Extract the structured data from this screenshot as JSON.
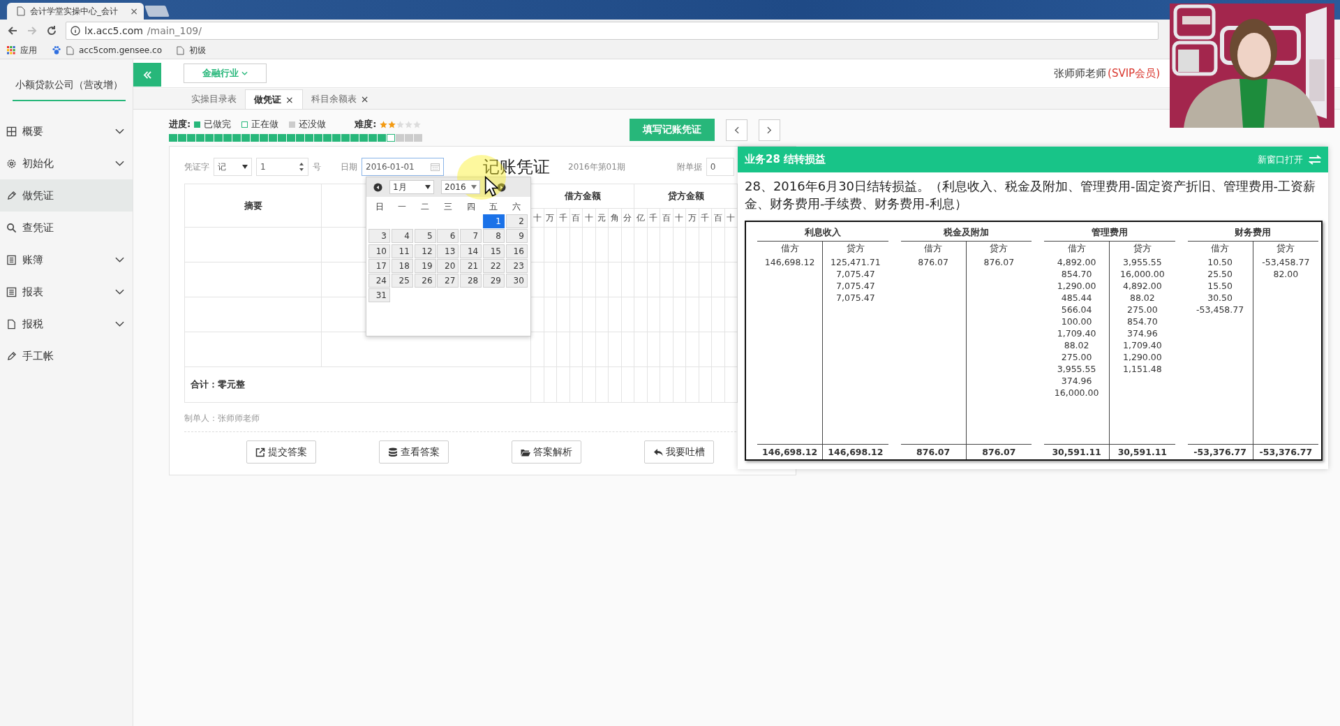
{
  "browser": {
    "tab_title": "会计学堂实操中心_会计",
    "tab_close": "×",
    "url_host": "lx.acc5.com",
    "url_path": "/main_109/",
    "bookmarks": [
      "应用",
      "acc5com.gensee.co",
      "初级"
    ]
  },
  "sidebar": {
    "company": "小额贷款公司（营改增）",
    "items": [
      {
        "label": "概要",
        "kind": "group",
        "selected": false
      },
      {
        "label": "初始化",
        "kind": "group",
        "selected": false
      },
      {
        "label": "做凭证",
        "kind": "link",
        "selected": true
      },
      {
        "label": "查凭证",
        "kind": "link",
        "selected": false
      },
      {
        "label": "账簿",
        "kind": "group",
        "selected": false
      },
      {
        "label": "报表",
        "kind": "group",
        "selected": false
      },
      {
        "label": "报税",
        "kind": "group",
        "selected": false
      },
      {
        "label": "手工帐",
        "kind": "link",
        "selected": false
      }
    ]
  },
  "topbar": {
    "industry": "金融行业",
    "user": "张师师老师",
    "member": "(SVIP会员)"
  },
  "tabs": [
    {
      "label": "实操目录表",
      "selected": false
    },
    {
      "label": "做凭证",
      "selected": true,
      "close": "×"
    },
    {
      "label": "科目余额表",
      "selected": false,
      "close": "×"
    }
  ],
  "progress": {
    "label": "进度:",
    "legend": [
      {
        "label": "已做完",
        "kind": "done"
      },
      {
        "label": "正在做",
        "kind": "current"
      },
      {
        "label": "还没做",
        "kind": "todo"
      }
    ],
    "steps": [
      {
        "kind": "done"
      },
      {
        "kind": "done"
      },
      {
        "kind": "done"
      },
      {
        "kind": "done"
      },
      {
        "kind": "done"
      },
      {
        "kind": "done"
      },
      {
        "kind": "done"
      },
      {
        "kind": "done"
      },
      {
        "kind": "done"
      },
      {
        "kind": "done"
      },
      {
        "kind": "done"
      },
      {
        "kind": "done"
      },
      {
        "kind": "done"
      },
      {
        "kind": "done"
      },
      {
        "kind": "done"
      },
      {
        "kind": "done"
      },
      {
        "kind": "done"
      },
      {
        "kind": "done"
      },
      {
        "kind": "done"
      },
      {
        "kind": "done"
      },
      {
        "kind": "done"
      },
      {
        "kind": "done"
      },
      {
        "kind": "done"
      },
      {
        "kind": "done"
      },
      {
        "kind": "current"
      },
      {
        "kind": "todo"
      },
      {
        "kind": "todo"
      },
      {
        "kind": "todo"
      }
    ],
    "difficulty_label": "难度:",
    "stars": 2
  },
  "fill_button": "填写记账凭证",
  "voucher": {
    "word_label": "凭证字",
    "word": "记",
    "number": "1",
    "number_suffix": "号",
    "date_label": "日期",
    "date": "2016-01-01",
    "title": "记账凭证",
    "period": "2016年第01期",
    "attachments_label": "附单据",
    "attachments": "0",
    "summary_header": "摘要",
    "debit_header": "借方金额",
    "credit_header": "贷方金额",
    "debit_digits": [
      "十",
      "万",
      "千",
      "百",
      "十",
      "元",
      "角",
      "分"
    ],
    "credit_digits": [
      "亿",
      "千",
      "百",
      "十",
      "万",
      "千",
      "百",
      "十"
    ],
    "total": "合计：零元整",
    "maker": "制单人：张师师老师",
    "actions": [
      "提交答案",
      "查看答案",
      "答案解析",
      "我要吐槽"
    ]
  },
  "calendar": {
    "month": "1月",
    "year": "2016",
    "weekdays": [
      "日",
      "一",
      "二",
      "三",
      "四",
      "五",
      "六"
    ],
    "weeks": [
      [
        {
          "label": "1",
          "selected": true
        },
        {
          "label": "2",
          "selected": false
        }
      ],
      [
        {
          "label": "3",
          "selected": false
        },
        {
          "label": "4",
          "selected": false
        },
        {
          "label": "5",
          "selected": false
        },
        {
          "label": "6",
          "selected": false
        },
        {
          "label": "7",
          "selected": false
        },
        {
          "label": "8",
          "selected": false
        },
        {
          "label": "9",
          "selected": false
        }
      ],
      [
        {
          "label": "10",
          "selected": false
        },
        {
          "label": "11",
          "selected": false
        },
        {
          "label": "12",
          "selected": false
        },
        {
          "label": "13",
          "selected": false
        },
        {
          "label": "14",
          "selected": false
        },
        {
          "label": "15",
          "selected": false
        },
        {
          "label": "16",
          "selected": false
        }
      ],
      [
        {
          "label": "17",
          "selected": false
        },
        {
          "label": "18",
          "selected": false
        },
        {
          "label": "19",
          "selected": false
        },
        {
          "label": "20",
          "selected": false
        },
        {
          "label": "21",
          "selected": false
        },
        {
          "label": "22",
          "selected": false
        },
        {
          "label": "23",
          "selected": false
        }
      ],
      [
        {
          "label": "24",
          "selected": false
        },
        {
          "label": "25",
          "selected": false
        },
        {
          "label": "26",
          "selected": false
        },
        {
          "label": "27",
          "selected": false
        },
        {
          "label": "28",
          "selected": false
        },
        {
          "label": "29",
          "selected": false
        },
        {
          "label": "30",
          "selected": false
        }
      ],
      [
        {
          "label": "31",
          "selected": false
        }
      ]
    ]
  },
  "panel": {
    "title": "业务28 结转损益",
    "open_new": "新窗口打开",
    "question": "28、2016年6月30日结转损益。（利息收入、税金及附加、管理费用-固定资产折旧、管理费用-工资薪金、财务费用-手续费、财务费用-利息）",
    "accounts": [
      {
        "name": "利息收入",
        "debit_label": "借方",
        "credit_label": "贷方",
        "debit": [
          "146,698.12"
        ],
        "credit": [
          "125,471.71",
          "7,075.47",
          "7,075.47",
          "7,075.47"
        ],
        "debit_total": "146,698.12",
        "credit_total": "146,698.12"
      },
      {
        "name": "税金及附加",
        "debit_label": "借方",
        "credit_label": "贷方",
        "debit": [
          "876.07"
        ],
        "credit": [
          "876.07"
        ],
        "debit_total": "876.07",
        "credit_total": "876.07"
      },
      {
        "name": "管理费用",
        "debit_label": "借方",
        "credit_label": "贷方",
        "debit": [
          "4,892.00",
          "854.70",
          "1,290.00",
          "485.44",
          "566.04",
          "100.00",
          "1,709.40",
          "88.02",
          "275.00",
          "3,955.55",
          "374.96",
          "16,000.00"
        ],
        "credit": [
          "3,955.55",
          "16,000.00",
          "4,892.00",
          "88.02",
          "275.00",
          "854.70",
          "374.96",
          "1,709.40",
          "1,290.00",
          "1,151.48"
        ],
        "debit_total": "30,591.11",
        "credit_total": "30,591.11"
      },
      {
        "name": "财务费用",
        "debit_label": "借方",
        "credit_label": "贷方",
        "debit": [
          "10.50",
          "25.50",
          "15.50",
          "30.50",
          "-53,458.77"
        ],
        "credit": [
          "-53,458.77",
          "82.00"
        ],
        "debit_total": "-53,376.77",
        "credit_total": "-53,376.77"
      }
    ]
  }
}
